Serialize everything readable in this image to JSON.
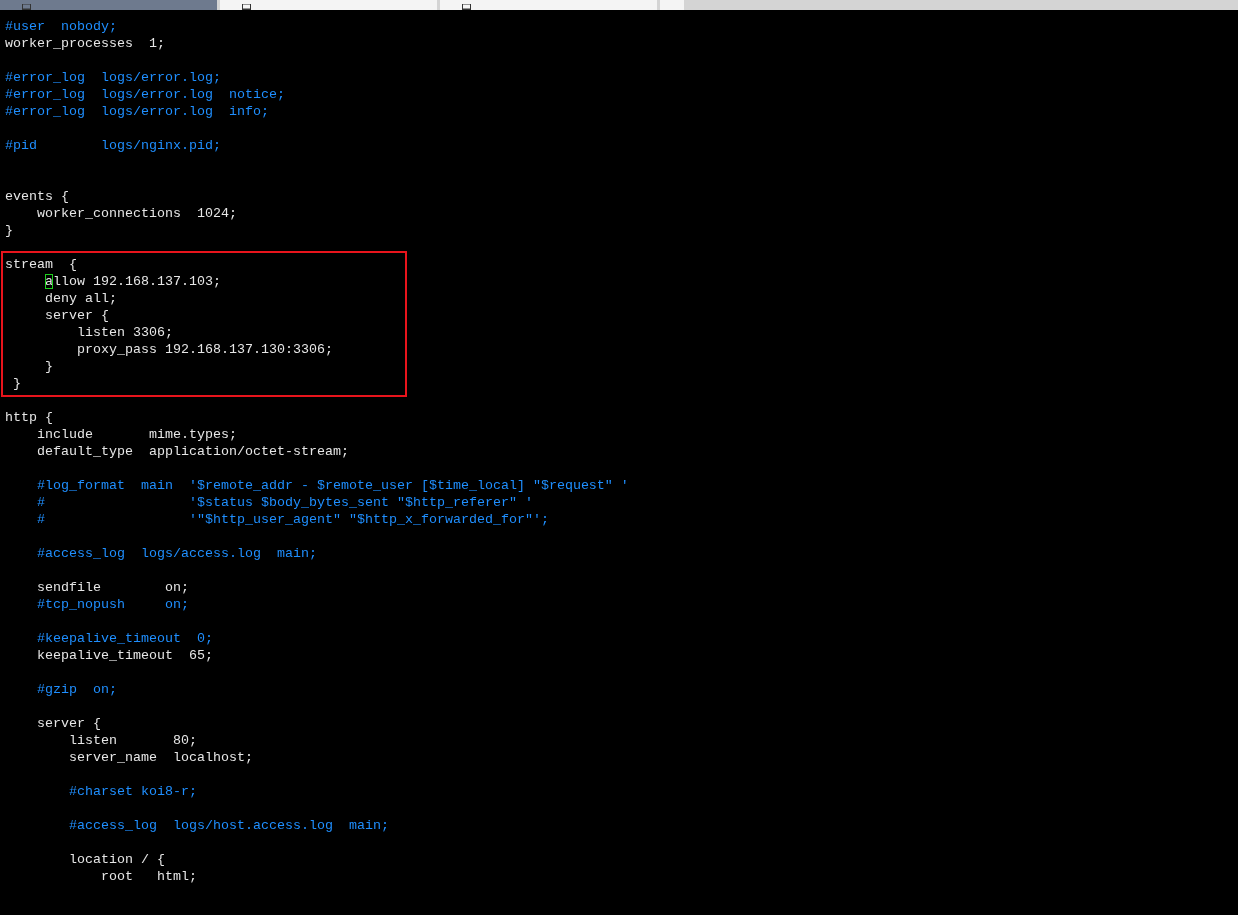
{
  "tabs": [
    {
      "selected": true
    },
    {
      "selected": false
    },
    {
      "selected": false
    },
    {
      "selected": false,
      "kind": "empty"
    }
  ],
  "blocks": [
    {
      "highlighted": false,
      "lines": [
        {
          "kind": "comment",
          "text": "#user  nobody;"
        },
        {
          "kind": "code",
          "text": "worker_processes  1;"
        },
        {
          "kind": "blank"
        },
        {
          "kind": "comment",
          "text": "#error_log  logs/error.log;"
        },
        {
          "kind": "comment",
          "text": "#error_log  logs/error.log  notice;"
        },
        {
          "kind": "comment",
          "text": "#error_log  logs/error.log  info;"
        },
        {
          "kind": "blank"
        },
        {
          "kind": "comment",
          "text": "#pid        logs/nginx.pid;"
        },
        {
          "kind": "blank"
        },
        {
          "kind": "blank"
        },
        {
          "kind": "code",
          "text": "events {"
        },
        {
          "kind": "code",
          "text": "    worker_connections  1024;"
        },
        {
          "kind": "code",
          "text": "}"
        },
        {
          "kind": "blank"
        }
      ]
    },
    {
      "highlighted": true,
      "lines": [
        {
          "kind": "code",
          "text": "stream  {"
        },
        {
          "kind": "code",
          "text": "     allow 192.168.137.103;",
          "cursor": true
        },
        {
          "kind": "code",
          "text": "     deny all;"
        },
        {
          "kind": "code",
          "text": "     server {"
        },
        {
          "kind": "code",
          "text": "         listen 3306;"
        },
        {
          "kind": "code",
          "text": "         proxy_pass 192.168.137.130:3306;"
        },
        {
          "kind": "code",
          "text": "     }"
        },
        {
          "kind": "code",
          "text": " }"
        }
      ]
    },
    {
      "highlighted": false,
      "lines": [
        {
          "kind": "blank"
        },
        {
          "kind": "code",
          "text": "http {"
        },
        {
          "kind": "code",
          "text": "    include       mime.types;"
        },
        {
          "kind": "code",
          "text": "    default_type  application/octet-stream;"
        },
        {
          "kind": "blank"
        },
        {
          "kind": "comment",
          "text": "    #log_format  main  '$remote_addr - $remote_user [$time_local] \"$request\" '"
        },
        {
          "kind": "comment",
          "text": "    #                  '$status $body_bytes_sent \"$http_referer\" '"
        },
        {
          "kind": "comment",
          "text": "    #                  '\"$http_user_agent\" \"$http_x_forwarded_for\"';"
        },
        {
          "kind": "blank"
        },
        {
          "kind": "comment",
          "text": "    #access_log  logs/access.log  main;"
        },
        {
          "kind": "blank"
        },
        {
          "kind": "code",
          "text": "    sendfile        on;"
        },
        {
          "kind": "comment",
          "text": "    #tcp_nopush     on;"
        },
        {
          "kind": "blank"
        },
        {
          "kind": "comment",
          "text": "    #keepalive_timeout  0;"
        },
        {
          "kind": "code",
          "text": "    keepalive_timeout  65;"
        },
        {
          "kind": "blank"
        },
        {
          "kind": "comment",
          "text": "    #gzip  on;"
        },
        {
          "kind": "blank"
        },
        {
          "kind": "code",
          "text": "    server {"
        },
        {
          "kind": "code",
          "text": "        listen       80;"
        },
        {
          "kind": "code",
          "text": "        server_name  localhost;"
        },
        {
          "kind": "blank"
        },
        {
          "kind": "comment",
          "text": "        #charset koi8-r;"
        },
        {
          "kind": "blank"
        },
        {
          "kind": "comment",
          "text": "        #access_log  logs/host.access.log  main;"
        },
        {
          "kind": "blank"
        },
        {
          "kind": "code",
          "text": "        location / {"
        },
        {
          "kind": "code",
          "text": "            root   html;"
        }
      ]
    }
  ]
}
